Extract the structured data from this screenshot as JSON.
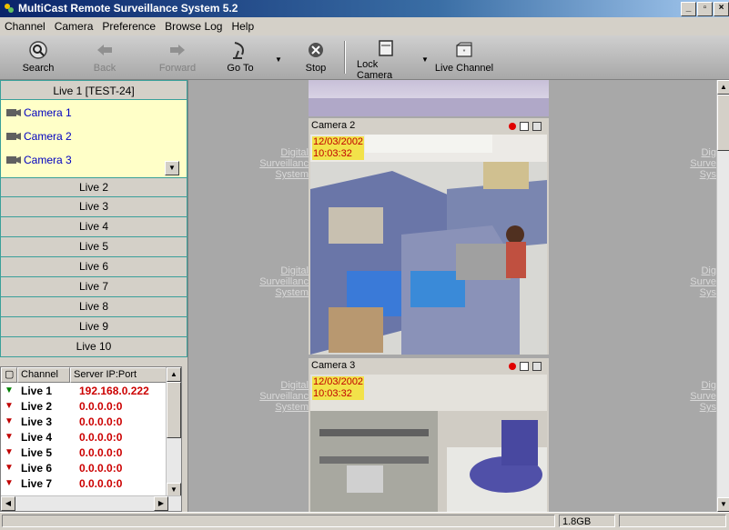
{
  "window": {
    "title": "MultiCast Remote Surveillance System 5.2"
  },
  "menu": [
    "Channel",
    "Camera",
    "Preference",
    "Browse Log",
    "Help"
  ],
  "toolbar": {
    "search": "Search",
    "back": "Back",
    "forward": "Forward",
    "goto": "Go To",
    "stop": "Stop",
    "lock_camera": "Lock Camera",
    "live_channel": "Live Channel"
  },
  "live_groups": {
    "active": "Live 1 [TEST-24]",
    "cameras": [
      "Camera 1",
      "Camera 2",
      "Camera 3"
    ],
    "others": [
      "Live 2",
      "Live 3",
      "Live 4",
      "Live 5",
      "Live 6",
      "Live 7",
      "Live 8",
      "Live 9",
      "Live 10"
    ]
  },
  "channel_table": {
    "headers": [
      "Channel",
      "Server IP:Port"
    ],
    "rows": [
      {
        "channel": "Live 1",
        "ip": "192.168.0.222",
        "status": "green"
      },
      {
        "channel": "Live 2",
        "ip": "0.0.0.0:0",
        "status": "red"
      },
      {
        "channel": "Live 3",
        "ip": "0.0.0.0:0",
        "status": "red"
      },
      {
        "channel": "Live 4",
        "ip": "0.0.0.0:0",
        "status": "red"
      },
      {
        "channel": "Live 5",
        "ip": "0.0.0.0:0",
        "status": "red"
      },
      {
        "channel": "Live 6",
        "ip": "0.0.0.0:0",
        "status": "red"
      },
      {
        "channel": "Live 7",
        "ip": "0.0.0.0:0",
        "status": "red"
      }
    ]
  },
  "watermark": {
    "line1": "Digital",
    "line2": "Surveillanc",
    "line3": "System",
    "right1": "Dig",
    "right2": "Surve",
    "right3": "Sys"
  },
  "cameras": [
    {
      "title": "Camera 2",
      "date": "12/03/2002",
      "time": "10:03:32"
    },
    {
      "title": "Camera 3",
      "date": "12/03/2002",
      "time": "10:03:32"
    }
  ],
  "status": {
    "disk": "1.8GB"
  }
}
